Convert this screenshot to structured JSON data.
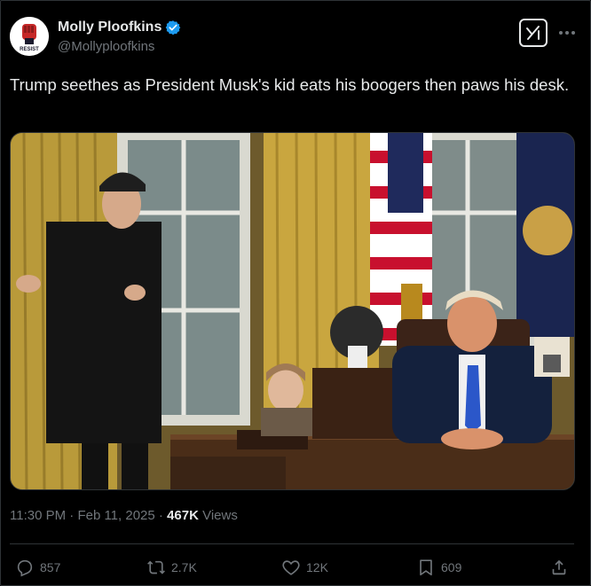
{
  "author": {
    "display_name": "Molly Ploofkins",
    "handle": "@Mollyploofkins",
    "avatar_text": "RESIST",
    "verified_color": "#1d9bf0"
  },
  "post": {
    "text": "Trump seethes as President Musk's kid eats his boogers then paws his desk.",
    "media_description_icon": "photo"
  },
  "meta": {
    "time": "11:30 PM",
    "separator": "·",
    "date": "Feb 11, 2025",
    "separator2": "·",
    "views_count": "467K",
    "views_label": "Views"
  },
  "actions": {
    "replies": "857",
    "reposts": "2.7K",
    "likes": "12K",
    "bookmarks": "609"
  },
  "colors": {
    "background": "#000000",
    "text": "#e7e9ea",
    "muted": "#71767b",
    "border": "#2f3336",
    "accent": "#1d9bf0"
  },
  "icons": {
    "grok": "grok-icon",
    "more": "more-icon",
    "reply": "reply-icon",
    "repost": "repost-icon",
    "like": "heart-icon",
    "bookmark": "bookmark-icon",
    "share": "share-icon"
  }
}
